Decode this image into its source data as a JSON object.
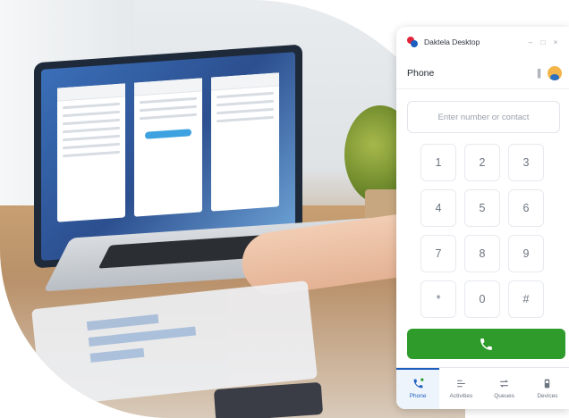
{
  "app": {
    "window_title": "Daktela Desktop",
    "section_title": "Phone",
    "pause_glyph": "||",
    "window_controls": [
      "–",
      "□",
      "×"
    ]
  },
  "dialer": {
    "placeholder": "Enter number or contact",
    "keys": [
      "1",
      "2",
      "3",
      "4",
      "5",
      "6",
      "7",
      "8",
      "9",
      "*",
      "0",
      "#"
    ]
  },
  "tabs": [
    {
      "label": "Phone",
      "icon": "phone-icon",
      "active": true
    },
    {
      "label": "Activities",
      "icon": "activities-icon",
      "active": false
    },
    {
      "label": "Queues",
      "icon": "queues-icon",
      "active": false
    },
    {
      "label": "Devices",
      "icon": "device-icon",
      "active": false
    }
  ],
  "colors": {
    "call_green": "#2f9b2b",
    "accent_blue": "#1d5fbf",
    "logo_red": "#e2233c"
  }
}
